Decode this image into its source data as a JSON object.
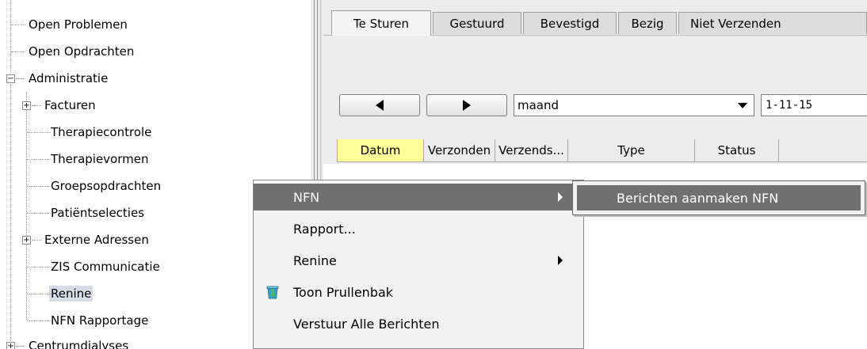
{
  "tree": {
    "items": [
      {
        "label": "Open Problemen"
      },
      {
        "label": "Open Opdrachten"
      },
      {
        "label": "Administratie"
      },
      {
        "label": "Facturen"
      },
      {
        "label": "Therapiecontrole"
      },
      {
        "label": "Therapievormen"
      },
      {
        "label": "Groepsopdrachten"
      },
      {
        "label": "Patiëntselecties"
      },
      {
        "label": "Externe Adressen"
      },
      {
        "label": "ZIS Communicatie"
      },
      {
        "label": "Renine"
      },
      {
        "label": "NFN Rapportage"
      },
      {
        "label": "Centrumdialyses"
      }
    ]
  },
  "tabs": [
    {
      "label": "Te Sturen",
      "active": true
    },
    {
      "label": "Gestuurd"
    },
    {
      "label": "Bevestigd"
    },
    {
      "label": "Bezig"
    },
    {
      "label": "Niet Verzenden"
    }
  ],
  "toolbar": {
    "prev_icon": "triangle-left-icon",
    "next_icon": "triangle-right-icon",
    "period_value": "maand",
    "date_value": "1-11-15"
  },
  "grid": {
    "columns": [
      "Datum",
      "Verzonden",
      "Verzends...",
      "Type",
      "Status"
    ],
    "sorted_column": "Datum",
    "sorted_color": "#ffff99"
  },
  "context_menu": {
    "items": [
      {
        "label": "NFN",
        "has_submenu": true,
        "highlighted": true
      },
      {
        "label": "Rapport..."
      },
      {
        "label": "Renine",
        "has_submenu": true
      },
      {
        "label": "Toon Prullenbak",
        "icon": "recycle-bin-icon"
      },
      {
        "label": "Verstuur Alle Berichten"
      }
    ],
    "highlight_color": "#707070"
  },
  "submenu": {
    "items": [
      {
        "label": "Berichten aanmaken NFN"
      }
    ]
  }
}
